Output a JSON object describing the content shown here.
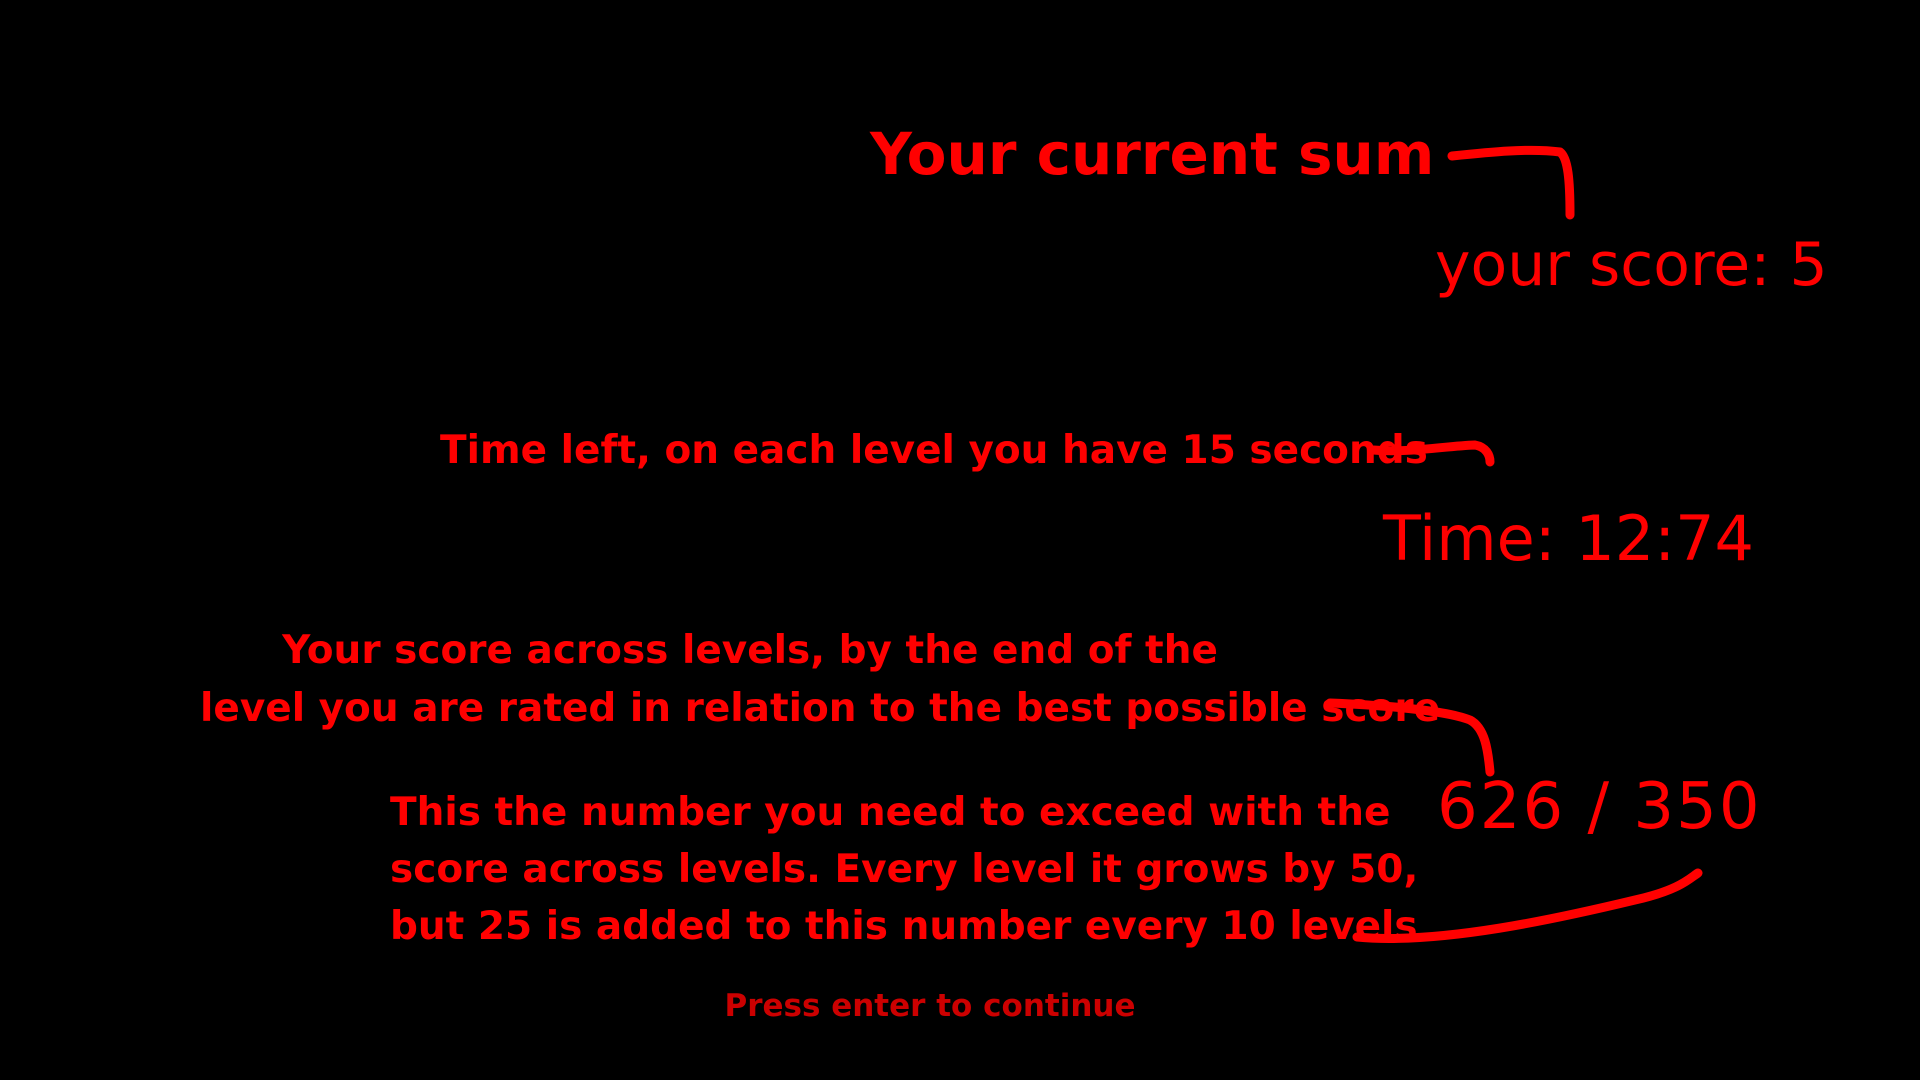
{
  "screen": {
    "background_color": "#000000",
    "text_color": "#ff0000"
  },
  "annotations": {
    "current_sum": "Your current sum",
    "time_left": "Time left, on each level you have 15 seconds",
    "score_across_levels": {
      "line1": "Your score across levels, by the end of the",
      "line2": "level you are rated in relation to the best possible score"
    },
    "target_number": {
      "line1": "This the number you need to exceed with the",
      "line2": "score across levels. Every level it grows by 50,",
      "line3": "but 25 is added to this number every 10 levels"
    }
  },
  "hud": {
    "score_label": "your score: 5",
    "time_label": "Time: 12:74",
    "progress_label": "626 / 350"
  },
  "prompt": {
    "continue": "Press enter to continue"
  }
}
